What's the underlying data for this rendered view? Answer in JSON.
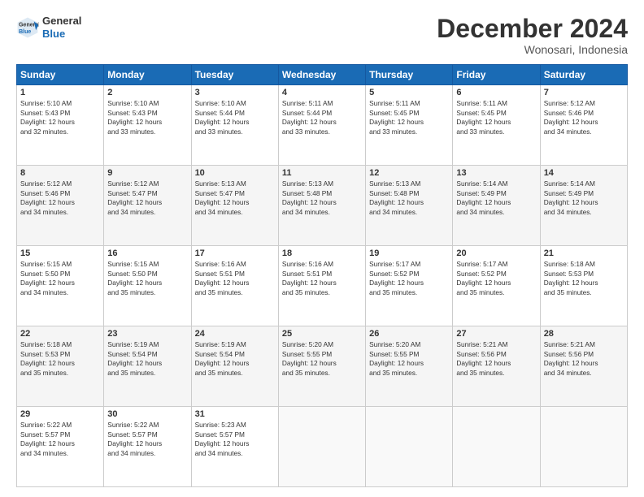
{
  "header": {
    "logo_general": "General",
    "logo_blue": "Blue",
    "month_year": "December 2024",
    "location": "Wonosari, Indonesia"
  },
  "days_of_week": [
    "Sunday",
    "Monday",
    "Tuesday",
    "Wednesday",
    "Thursday",
    "Friday",
    "Saturday"
  ],
  "weeks": [
    [
      {
        "day": "1",
        "lines": [
          "Sunrise: 5:10 AM",
          "Sunset: 5:43 PM",
          "Daylight: 12 hours",
          "and 32 minutes."
        ]
      },
      {
        "day": "2",
        "lines": [
          "Sunrise: 5:10 AM",
          "Sunset: 5:43 PM",
          "Daylight: 12 hours",
          "and 33 minutes."
        ]
      },
      {
        "day": "3",
        "lines": [
          "Sunrise: 5:10 AM",
          "Sunset: 5:44 PM",
          "Daylight: 12 hours",
          "and 33 minutes."
        ]
      },
      {
        "day": "4",
        "lines": [
          "Sunrise: 5:11 AM",
          "Sunset: 5:44 PM",
          "Daylight: 12 hours",
          "and 33 minutes."
        ]
      },
      {
        "day": "5",
        "lines": [
          "Sunrise: 5:11 AM",
          "Sunset: 5:45 PM",
          "Daylight: 12 hours",
          "and 33 minutes."
        ]
      },
      {
        "day": "6",
        "lines": [
          "Sunrise: 5:11 AM",
          "Sunset: 5:45 PM",
          "Daylight: 12 hours",
          "and 33 minutes."
        ]
      },
      {
        "day": "7",
        "lines": [
          "Sunrise: 5:12 AM",
          "Sunset: 5:46 PM",
          "Daylight: 12 hours",
          "and 34 minutes."
        ]
      }
    ],
    [
      {
        "day": "8",
        "lines": [
          "Sunrise: 5:12 AM",
          "Sunset: 5:46 PM",
          "Daylight: 12 hours",
          "and 34 minutes."
        ]
      },
      {
        "day": "9",
        "lines": [
          "Sunrise: 5:12 AM",
          "Sunset: 5:47 PM",
          "Daylight: 12 hours",
          "and 34 minutes."
        ]
      },
      {
        "day": "10",
        "lines": [
          "Sunrise: 5:13 AM",
          "Sunset: 5:47 PM",
          "Daylight: 12 hours",
          "and 34 minutes."
        ]
      },
      {
        "day": "11",
        "lines": [
          "Sunrise: 5:13 AM",
          "Sunset: 5:48 PM",
          "Daylight: 12 hours",
          "and 34 minutes."
        ]
      },
      {
        "day": "12",
        "lines": [
          "Sunrise: 5:13 AM",
          "Sunset: 5:48 PM",
          "Daylight: 12 hours",
          "and 34 minutes."
        ]
      },
      {
        "day": "13",
        "lines": [
          "Sunrise: 5:14 AM",
          "Sunset: 5:49 PM",
          "Daylight: 12 hours",
          "and 34 minutes."
        ]
      },
      {
        "day": "14",
        "lines": [
          "Sunrise: 5:14 AM",
          "Sunset: 5:49 PM",
          "Daylight: 12 hours",
          "and 34 minutes."
        ]
      }
    ],
    [
      {
        "day": "15",
        "lines": [
          "Sunrise: 5:15 AM",
          "Sunset: 5:50 PM",
          "Daylight: 12 hours",
          "and 34 minutes."
        ]
      },
      {
        "day": "16",
        "lines": [
          "Sunrise: 5:15 AM",
          "Sunset: 5:50 PM",
          "Daylight: 12 hours",
          "and 35 minutes."
        ]
      },
      {
        "day": "17",
        "lines": [
          "Sunrise: 5:16 AM",
          "Sunset: 5:51 PM",
          "Daylight: 12 hours",
          "and 35 minutes."
        ]
      },
      {
        "day": "18",
        "lines": [
          "Sunrise: 5:16 AM",
          "Sunset: 5:51 PM",
          "Daylight: 12 hours",
          "and 35 minutes."
        ]
      },
      {
        "day": "19",
        "lines": [
          "Sunrise: 5:17 AM",
          "Sunset: 5:52 PM",
          "Daylight: 12 hours",
          "and 35 minutes."
        ]
      },
      {
        "day": "20",
        "lines": [
          "Sunrise: 5:17 AM",
          "Sunset: 5:52 PM",
          "Daylight: 12 hours",
          "and 35 minutes."
        ]
      },
      {
        "day": "21",
        "lines": [
          "Sunrise: 5:18 AM",
          "Sunset: 5:53 PM",
          "Daylight: 12 hours",
          "and 35 minutes."
        ]
      }
    ],
    [
      {
        "day": "22",
        "lines": [
          "Sunrise: 5:18 AM",
          "Sunset: 5:53 PM",
          "Daylight: 12 hours",
          "and 35 minutes."
        ]
      },
      {
        "day": "23",
        "lines": [
          "Sunrise: 5:19 AM",
          "Sunset: 5:54 PM",
          "Daylight: 12 hours",
          "and 35 minutes."
        ]
      },
      {
        "day": "24",
        "lines": [
          "Sunrise: 5:19 AM",
          "Sunset: 5:54 PM",
          "Daylight: 12 hours",
          "and 35 minutes."
        ]
      },
      {
        "day": "25",
        "lines": [
          "Sunrise: 5:20 AM",
          "Sunset: 5:55 PM",
          "Daylight: 12 hours",
          "and 35 minutes."
        ]
      },
      {
        "day": "26",
        "lines": [
          "Sunrise: 5:20 AM",
          "Sunset: 5:55 PM",
          "Daylight: 12 hours",
          "and 35 minutes."
        ]
      },
      {
        "day": "27",
        "lines": [
          "Sunrise: 5:21 AM",
          "Sunset: 5:56 PM",
          "Daylight: 12 hours",
          "and 35 minutes."
        ]
      },
      {
        "day": "28",
        "lines": [
          "Sunrise: 5:21 AM",
          "Sunset: 5:56 PM",
          "Daylight: 12 hours",
          "and 34 minutes."
        ]
      }
    ],
    [
      {
        "day": "29",
        "lines": [
          "Sunrise: 5:22 AM",
          "Sunset: 5:57 PM",
          "Daylight: 12 hours",
          "and 34 minutes."
        ]
      },
      {
        "day": "30",
        "lines": [
          "Sunrise: 5:22 AM",
          "Sunset: 5:57 PM",
          "Daylight: 12 hours",
          "and 34 minutes."
        ]
      },
      {
        "day": "31",
        "lines": [
          "Sunrise: 5:23 AM",
          "Sunset: 5:57 PM",
          "Daylight: 12 hours",
          "and 34 minutes."
        ]
      },
      null,
      null,
      null,
      null
    ]
  ]
}
